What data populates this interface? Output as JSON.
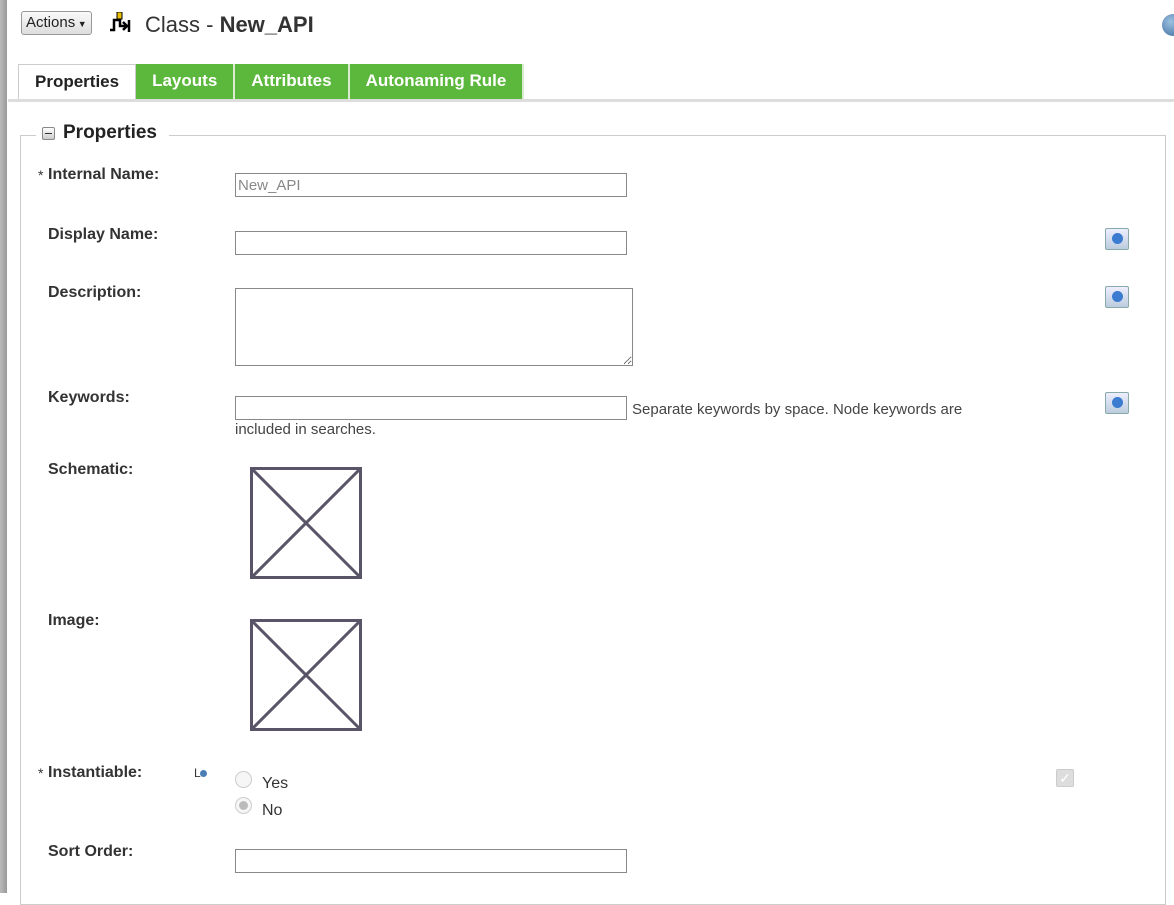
{
  "header": {
    "actions_label": "Actions",
    "class_prefix": "Class - ",
    "class_name": "New_API"
  },
  "tabs": [
    {
      "label": "Properties"
    },
    {
      "label": "Layouts"
    },
    {
      "label": "Attributes"
    },
    {
      "label": "Autonaming Rule"
    }
  ],
  "section": {
    "title": "Properties"
  },
  "fields": {
    "internal_name": {
      "label": "Internal Name:",
      "required": "*",
      "value": "New_API"
    },
    "display_name": {
      "label": "Display Name:",
      "value": ""
    },
    "description": {
      "label": "Description:",
      "value": ""
    },
    "keywords": {
      "label": "Keywords:",
      "value": "",
      "note": "Separate keywords by space. Node keywords are",
      "note2": "included in searches."
    },
    "schematic": {
      "label": "Schematic:"
    },
    "image": {
      "label": "Image:"
    },
    "instantiable": {
      "label": "Instantiable:",
      "required": "*",
      "options": [
        "Yes",
        "No"
      ],
      "selected": "No",
      "check": "✓"
    },
    "sort_order": {
      "label": "Sort Order:",
      "value": ""
    }
  }
}
